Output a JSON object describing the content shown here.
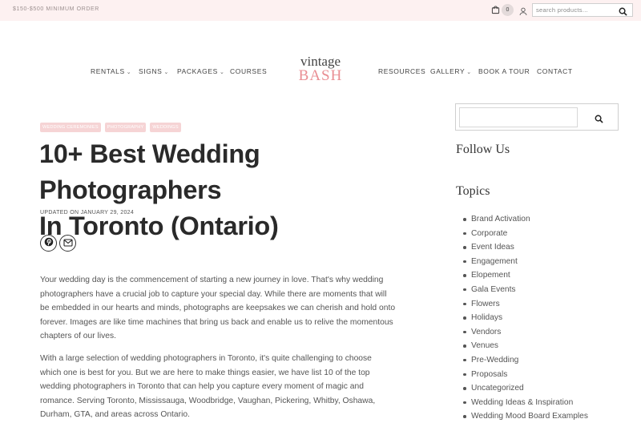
{
  "topbar": {
    "min_order": "$150-$500 MINIMUM ORDER",
    "cart_count": "0",
    "search_placeholder": "search products..."
  },
  "nav": {
    "left": [
      {
        "label": "RENTALS",
        "dropdown": true
      },
      {
        "label": "SIGNS",
        "dropdown": true
      },
      {
        "label": "PACKAGES",
        "dropdown": true
      },
      {
        "label": "COURSES",
        "dropdown": false
      }
    ],
    "logo_top": "vintage",
    "logo_bottom": "BASH",
    "right": [
      {
        "label": "RESOURCES",
        "dropdown": false
      },
      {
        "label": "GALLERY",
        "dropdown": true
      },
      {
        "label": "BOOK A TOUR",
        "dropdown": false
      },
      {
        "label": "CONTACT",
        "dropdown": false
      }
    ]
  },
  "article": {
    "tags": [
      "WEDDING CEREMONIES",
      "PHOTOGRAPHY",
      "WEDDINGS"
    ],
    "title_line1": "10+ Best Wedding Photographers",
    "title_line2": "In Toronto (Ontario)",
    "updated": "UPDATED ON JANUARY 29, 2024",
    "para1": [
      "Your wedding day is the commencement of starting a new journey in love. That's why wedding",
      "photographers have a crucial job to capture your special day. While there are moments that will",
      "be embedded in our hearts and minds, photographs are keepsakes we can cherish and hold onto",
      "forever. Images are like time machines that bring us back and enable us to relive the momentous",
      "chapters of our lives."
    ],
    "para2": [
      "With a large selection of wedding photographers in Toronto, it's quite challenging to choose",
      "which one is best for you. But we are here to make things easier, we have list 10 of the top",
      "wedding photographers in Toronto that can help you capture every moment of magic and",
      "romance. Serving Toronto, Mississauga, Woodbridge, Vaughan, Pickering, Whitby, Oshawa,",
      "Durham, GTA, and areas across Ontario."
    ]
  },
  "sidebar": {
    "follow_us": "Follow Us",
    "topics_heading": "Topics",
    "topics": [
      "Brand Activation",
      "Corporate",
      "Event Ideas",
      "Engagement",
      "Elopement",
      "Gala Events",
      "Flowers",
      "Holidays",
      "Vendors",
      "Venues",
      "Pre-Wedding",
      "Proposals",
      "Uncategorized",
      "Wedding Ideas & Inspiration",
      "Wedding Mood Board Examples"
    ]
  },
  "icons": {
    "cart": "shopping-cart-icon",
    "user": "user-icon",
    "search": "search-icon",
    "pinterest": "pinterest-icon",
    "email": "email-icon"
  },
  "colors": {
    "topbar_bg": "#fdf1f1",
    "brand_pink": "#e98e93",
    "tag_bg": "#f6d4d5"
  }
}
